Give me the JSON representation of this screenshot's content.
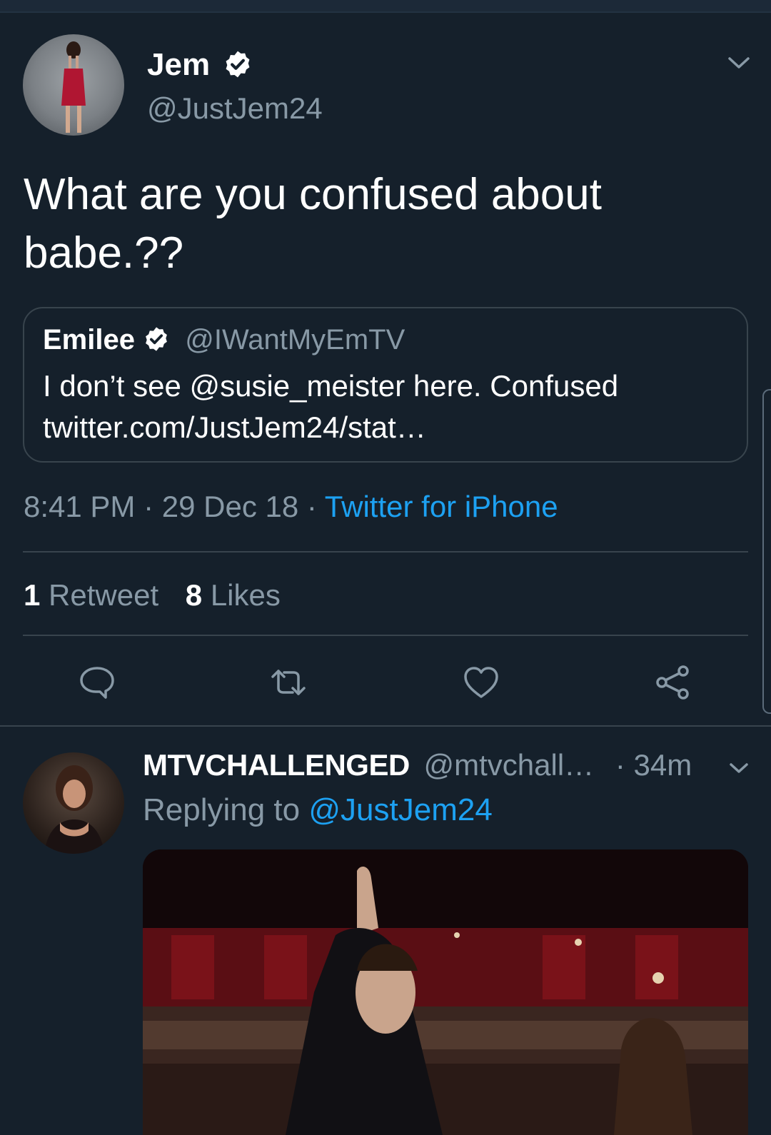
{
  "tweet": {
    "author_name": "Jem",
    "author_handle": "@JustJem24",
    "text": "What are you confused about babe.??",
    "quote": {
      "name": "Emilee",
      "handle": "@IWantMyEmTV",
      "text": "I don’t see @susie_meister here. Confused twitter.com/JustJem24/stat…"
    },
    "time": "8:41 PM",
    "date": "29 Dec 18",
    "source": "Twitter for iPhone",
    "retweet_count": "1",
    "retweet_label": "Retweet",
    "like_count": "8",
    "like_label": "Likes"
  },
  "reply": {
    "author_name": "MTVCHALLENGED",
    "author_handle": "@mtvchall…",
    "age": "· 34m",
    "replying_prefix": "Replying to",
    "replying_to": "@JustJem24"
  },
  "icons": {
    "verified": "verified-badge-icon",
    "more": "chevron-down-icon",
    "reply": "comment-icon",
    "retweet": "retweet-icon",
    "like": "heart-icon",
    "share": "share-icon"
  },
  "colors": {
    "background": "#15202b",
    "accent": "#1da1f2",
    "secondary_text": "#8899a6",
    "border": "#38444d"
  }
}
